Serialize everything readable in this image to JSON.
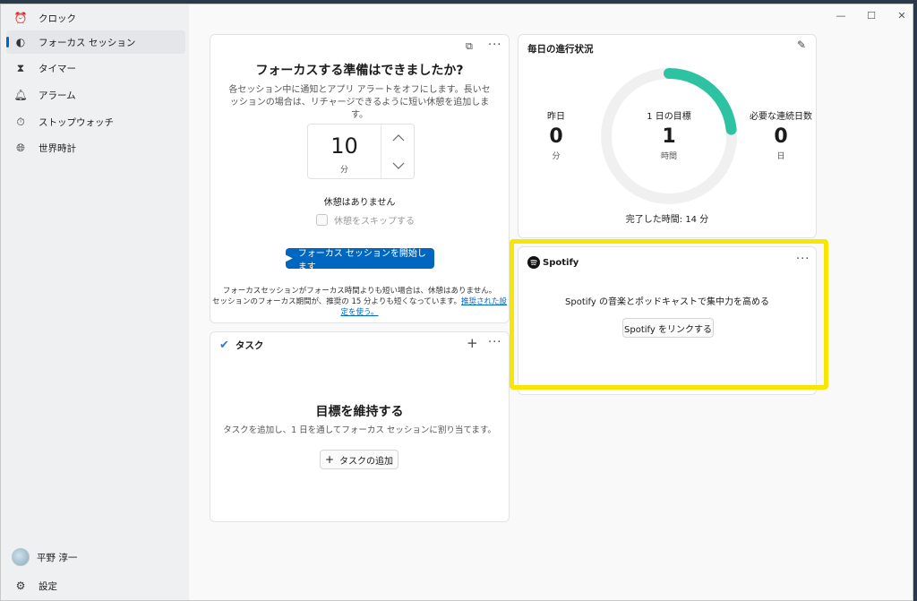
{
  "sidebar": {
    "items": [
      {
        "label": "クロック",
        "icon": "alarm-clock-icon"
      },
      {
        "label": "フォーカス セッション",
        "icon": "focus-icon"
      },
      {
        "label": "タイマー",
        "icon": "hourglass-icon"
      },
      {
        "label": "アラーム",
        "icon": "bell-icon"
      },
      {
        "label": "ストップウォッチ",
        "icon": "stopwatch-icon"
      },
      {
        "label": "世界時計",
        "icon": "globe-icon"
      }
    ],
    "user_name": "平野 淳一",
    "settings_label": "設定"
  },
  "focus": {
    "title": "フォーカスする準備はできましたか?",
    "description": "各セッション中に通知とアプリ アラートをオフにします。長いセッションの場合は、リチャージできるように短い休憩を追加します。",
    "minutes_value": "10",
    "minutes_unit": "分",
    "break_text": "休憩はありません",
    "skip_break_label": "休憩をスキップする",
    "start_button": "フォーカス セッションを開始します",
    "note_line1": "フォーカスセッションがフォーカス時間よりも短い場合は、休憩はありません。",
    "note_line2": "セッションのフォーカス期間が、推奨の 15 分よりも短くなっています。",
    "note_link": "推奨された設定を使う。"
  },
  "progress": {
    "title": "毎日の進行状況",
    "yesterday_label": "昨日",
    "yesterday_value": "0",
    "yesterday_unit": "分",
    "goal_label": "1 日の目標",
    "goal_value": "1",
    "goal_unit": "時間",
    "streak_label": "必要な連続日数",
    "streak_value": "0",
    "streak_unit": "日",
    "completed_text": "完了した時間: 14 分",
    "progress_fraction": 0.233,
    "ring_color": "#2dc3a2"
  },
  "tasks": {
    "title": "タスク",
    "heading": "目標を維持する",
    "description": "タスクを追加し、1 日を通してフォーカス セッションに割り当てます。",
    "add_button": "タスクの追加"
  },
  "spotify": {
    "logo_text": "Spotify",
    "message": "Spotify の音楽とポッドキャストで集中力を高める",
    "link_button": "Spotify をリンクする"
  },
  "colors": {
    "accent": "#0067c0",
    "highlight": "#f6e600"
  }
}
